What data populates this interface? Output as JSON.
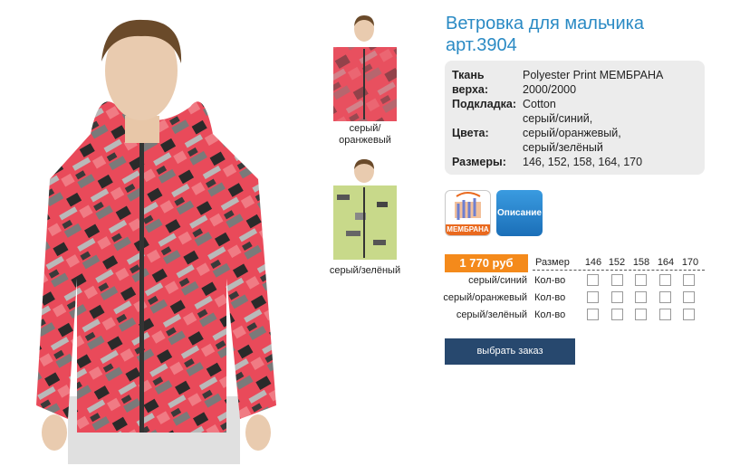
{
  "product": {
    "title": "Ветровка для мальчика арт.3904"
  },
  "specs": [
    {
      "key": "Ткань верха:",
      "value": "Polyester Print МЕМБРАНА 2000/2000"
    },
    {
      "key": "Подкладка:",
      "value": "Cotton"
    },
    {
      "key": "Цвета:",
      "value": "серый/синий, серый/оранжевый, серый/зелёный"
    },
    {
      "key": "Размеры:",
      "value": "146, 152, 158, 164, 170"
    }
  ],
  "specs_display": {
    "k1a": "Ткань",
    "k1b": "верха:",
    "v1a": "Polyester Print МЕМБРАНА",
    "v1b": "2000/2000",
    "k2": "Подкладка:",
    "v2": "Cotton",
    "k3": "Цвета:",
    "v3a": "серый/синий,",
    "v3b": "серый/оранжевый,",
    "v3c": "серый/зелёный",
    "k4": "Размеры:",
    "v4": "146, 152, 158, 164, 170"
  },
  "thumbnails": [
    {
      "caption_line1": "серый/",
      "caption_line2": "оранжевый"
    },
    {
      "caption": "серый/зелёный"
    }
  ],
  "buttons": {
    "membrana_label": "МЕМБРАНА",
    "description": "Описание",
    "order": "выбрать заказ"
  },
  "price": "1 770 руб",
  "order_table": {
    "size_header": "Размер",
    "sizes": [
      "146",
      "152",
      "158",
      "164",
      "170"
    ],
    "qty_label": "Кол-во",
    "rows": [
      {
        "color": "серый/синий"
      },
      {
        "color": "серый/оранжевый"
      },
      {
        "color": "серый/зелёный"
      }
    ]
  },
  "colors": {
    "title": "#2a8ac4",
    "price_bg": "#f48a1b",
    "order_btn_bg": "#27486e",
    "description_btn": "#2a85d0"
  }
}
